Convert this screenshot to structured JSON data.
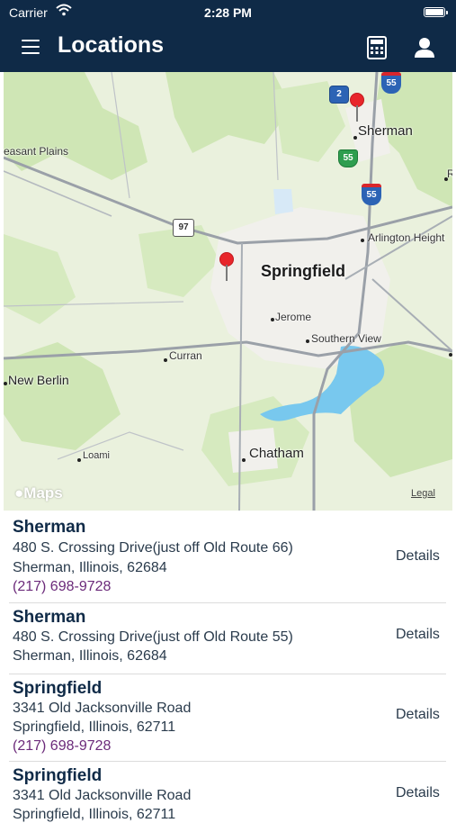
{
  "status_bar": {
    "carrier": "Carrier",
    "time": "2:28 PM"
  },
  "nav": {
    "title": "Locations",
    "menu_icon": "hamburger-menu-icon",
    "calculator_icon": "calculator-icon",
    "account_icon": "user-account-icon"
  },
  "map": {
    "places": {
      "sherman": "Sherman",
      "pleasant_plains": "easant Plains",
      "springfield": "Springfield",
      "arlington": "Arlington Height",
      "jerome": "Jerome",
      "southern_view": "Southern View",
      "curran": "Curran",
      "new_berlin": "New Berlin",
      "loami": "Loami",
      "chatham": "Chatham",
      "edge_r": "R"
    },
    "shields": {
      "route_97": "97",
      "route_2": "2",
      "interstate_55_a": "55",
      "us_55": "55",
      "interstate_55_b": "55"
    },
    "brand": "Maps",
    "legal": "Legal",
    "colors": {
      "land": "#eaf1dd",
      "park": "#cfe6b5",
      "urban": "#f1f0ec",
      "water": "#78c8ee",
      "road": "#9aa0a8",
      "pin": "#e8262b"
    }
  },
  "locations": [
    {
      "name": "Sherman",
      "address": "480 S. Crossing Drive(just off Old Route 66)",
      "city": "Sherman, Illinois, 62684",
      "phone": "(217) 698-9728",
      "action": "Details"
    },
    {
      "name": "Sherman",
      "address": "480 S. Crossing Drive(just off Old Route 55)",
      "city": "Sherman, Illinois, 62684",
      "phone": "",
      "action": "Details"
    },
    {
      "name": "Springfield",
      "address": "3341 Old Jacksonville Road",
      "city": "Springfield, Illinois, 62711",
      "phone": "(217) 698-9728",
      "action": "Details"
    },
    {
      "name": "Springfield",
      "address": "3341 Old Jacksonville Road",
      "city": "Springfield, Illinois, 62711",
      "phone": "",
      "action": "Details"
    }
  ]
}
